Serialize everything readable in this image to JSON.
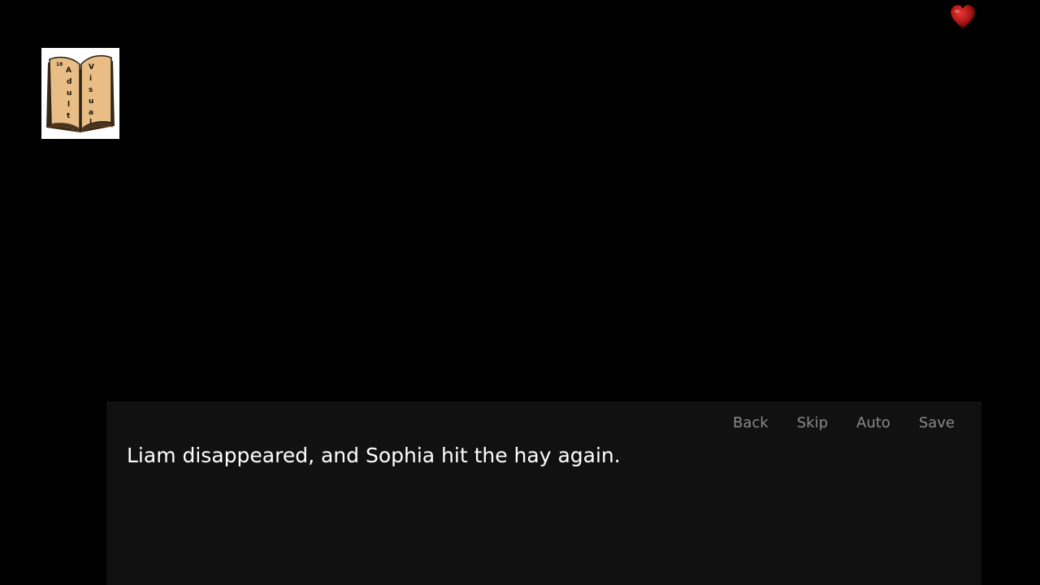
{
  "logo": {
    "icon": "open-book-icon",
    "lettering_left": "Adult",
    "lettering_right": "Visual",
    "corner_mark": "18"
  },
  "top_right": {
    "icon": "heart-icon",
    "color": "#b01818"
  },
  "quick_menu": {
    "back_label": "Back",
    "skip_label": "Skip",
    "auto_label": "Auto",
    "save_label": "Save",
    "color": "#8a8a8a"
  },
  "dialogue": {
    "text": "Liam disappeared, and Sophia hit the hay again."
  },
  "colors": {
    "background": "#000000",
    "dialogue_box": "#111111",
    "text": "#ffffff"
  }
}
